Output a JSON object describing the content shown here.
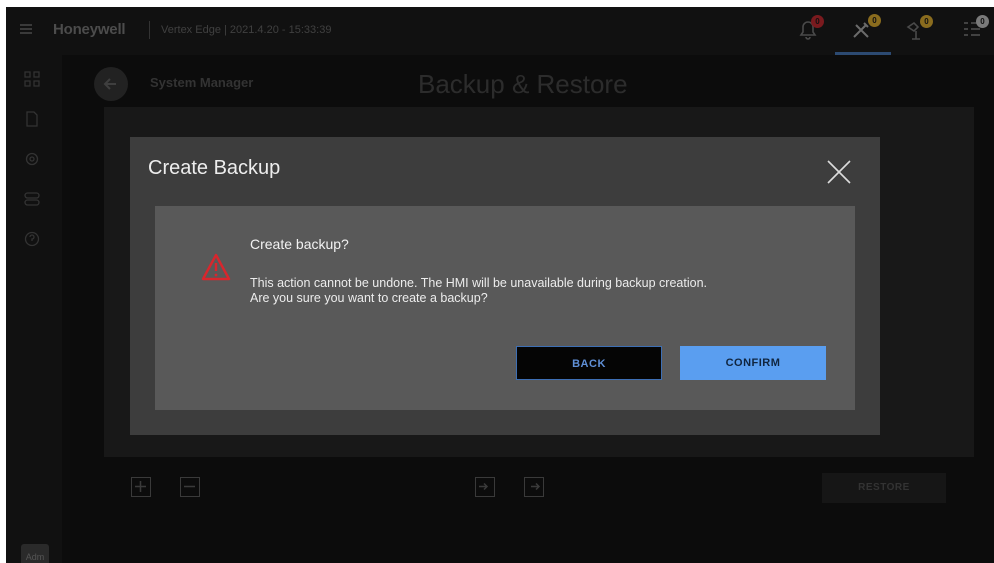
{
  "header": {
    "brand": "Honeywell",
    "subtitle": "Vertex Edge | 2021.4.20 - 15:33:39",
    "icons": [
      {
        "name": "bell-icon",
        "badge": "0",
        "badge_color": "#c2272d"
      },
      {
        "name": "tools-icon",
        "badge": "0",
        "badge_color": "#e8b52a"
      },
      {
        "name": "devices-icon",
        "badge": "0",
        "badge_color": "#e8b52a"
      },
      {
        "name": "list-icon",
        "badge": "0",
        "badge_color": "#cfcfcf"
      }
    ]
  },
  "sidebar": {
    "items": [
      "grid-icon",
      "document-icon",
      "settings-icon",
      "toggles-icon",
      "help-icon"
    ],
    "avatar": "Adm"
  },
  "page": {
    "breadcrumb": "System Manager",
    "title": "Backup & Restore",
    "restore_label": "RESTORE"
  },
  "modal": {
    "title": "Create Backup",
    "heading": "Create backup?",
    "message_line1": "This action cannot be undone. The HMI will be unavailable during backup creation.",
    "message_line2": "Are you sure you want to create a backup?",
    "back_label": "BACK",
    "confirm_label": "CONFIRM"
  },
  "colors": {
    "accent": "#5a9ef0",
    "warning": "#d8262d",
    "modal_bg": "#3d3d3d",
    "dialog_bg": "#595959"
  }
}
